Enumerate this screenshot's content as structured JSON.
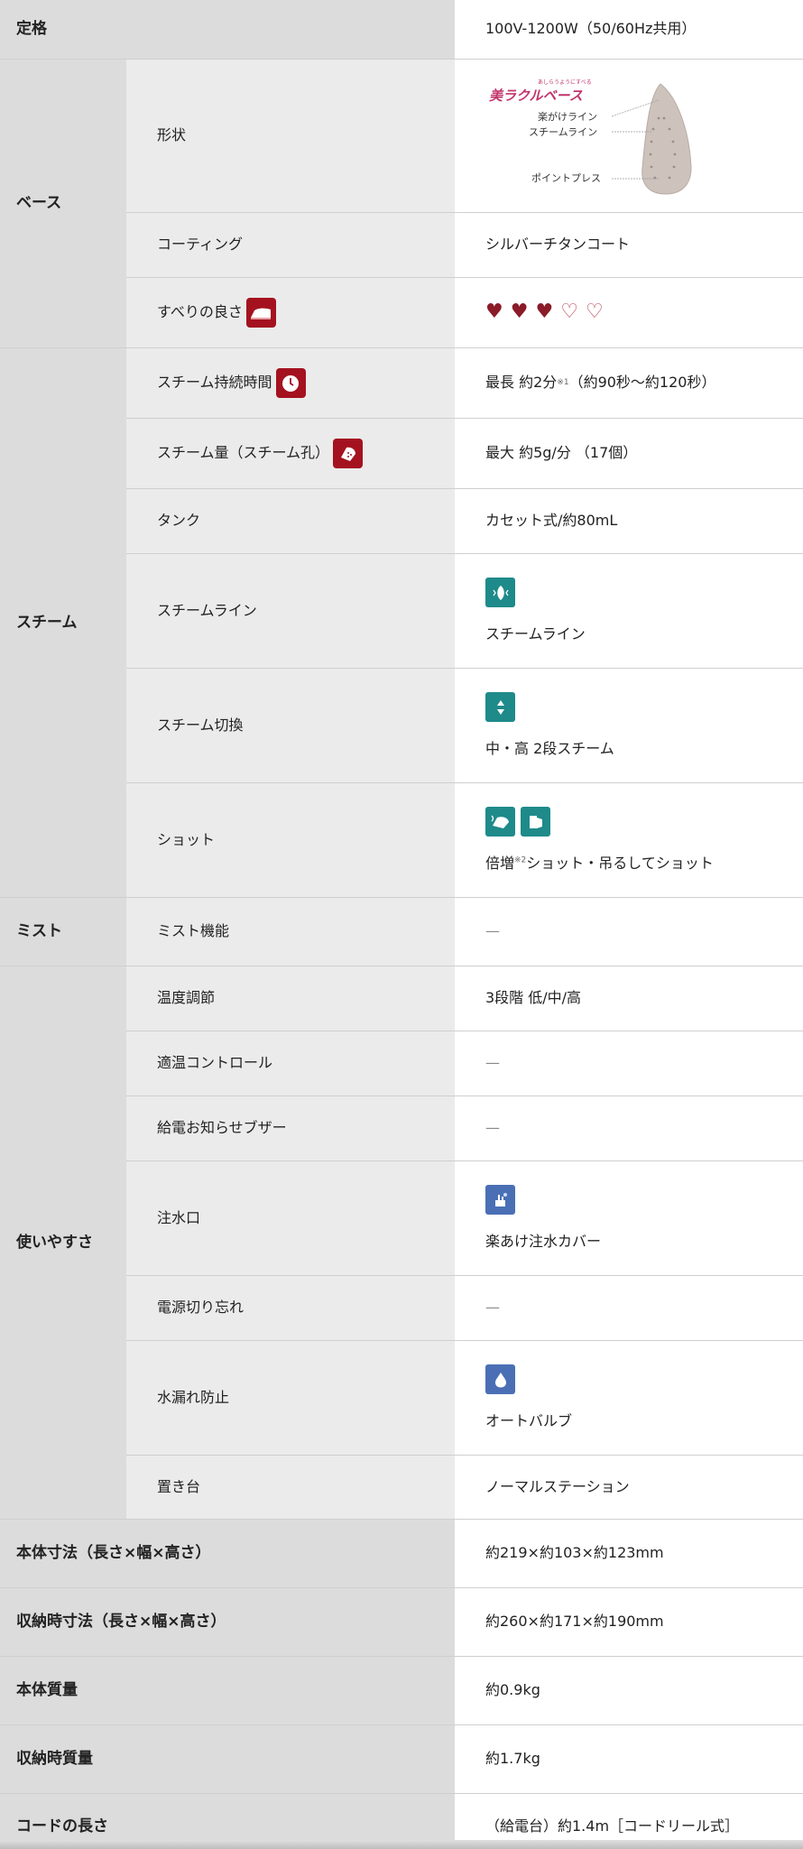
{
  "rows": {
    "rating": {
      "label": "定格",
      "value": "100V-1200W（50/60Hz共用）"
    },
    "base": {
      "category": "ベース",
      "shape": {
        "label": "形状",
        "image": {
          "brand_small": "あしらうようにすべる",
          "brand": "美ラクルベース",
          "line1": "楽がけライン",
          "line2": "スチームライン",
          "line3": "ポイントプレス"
        }
      },
      "coating": {
        "label": "コーティング",
        "value": "シルバーチタンコート"
      },
      "glide": {
        "label": "すべりの良さ",
        "rating": 3,
        "max": 5
      }
    },
    "steam": {
      "category": "スチーム",
      "duration": {
        "label": "スチーム持続時間",
        "value_pre": "最長 約2分",
        "note": "※1",
        "value_post": "（約90秒〜約120秒）"
      },
      "amount": {
        "label": "スチーム量（スチーム孔）",
        "value": "最大 約5g/分 （17個）"
      },
      "tank": {
        "label": "タンク",
        "value": "カセット式/約80mL"
      },
      "line": {
        "label": "スチームライン",
        "value": "スチームライン"
      },
      "switch": {
        "label": "スチーム切換",
        "value": "中・高 2段スチーム"
      },
      "shot": {
        "label": "ショット",
        "value_pre": "倍増",
        "note": "※2",
        "value_post": "ショット・吊るしてショット"
      }
    },
    "mist": {
      "category": "ミスト",
      "function": {
        "label": "ミスト機能",
        "value": "—"
      }
    },
    "usability": {
      "category": "使いやすさ",
      "temp": {
        "label": "温度調節",
        "value": "3段階 低/中/高"
      },
      "auto_temp": {
        "label": "適温コントロール",
        "value": "—"
      },
      "buzzer": {
        "label": "給電お知らせブザー",
        "value": "—"
      },
      "inlet": {
        "label": "注水口",
        "value": "楽あけ注水カバー"
      },
      "power_off": {
        "label": "電源切り忘れ",
        "value": "—"
      },
      "leak": {
        "label": "水漏れ防止",
        "value": "オートバルブ"
      },
      "stand": {
        "label": "置き台",
        "value": "ノーマルステーション"
      }
    },
    "body_size": {
      "label": "本体寸法（長さ×幅×高さ）",
      "value": "約219×約103×約123mm"
    },
    "storage_size": {
      "label": "収納時寸法（長さ×幅×高さ）",
      "value": "約260×約171×約190mm"
    },
    "body_weight": {
      "label": "本体質量",
      "value": "約0.9kg"
    },
    "storage_weight": {
      "label": "収納時質量",
      "value": "約1.7kg"
    },
    "cord": {
      "label": "コードの長さ",
      "value": "（給電台）約1.4m［コードリール式］"
    }
  },
  "colors": {
    "teal": "#1f8a8a",
    "blue": "#4a6fb5",
    "red": "#a4121f",
    "heart": "#8a1b28"
  }
}
